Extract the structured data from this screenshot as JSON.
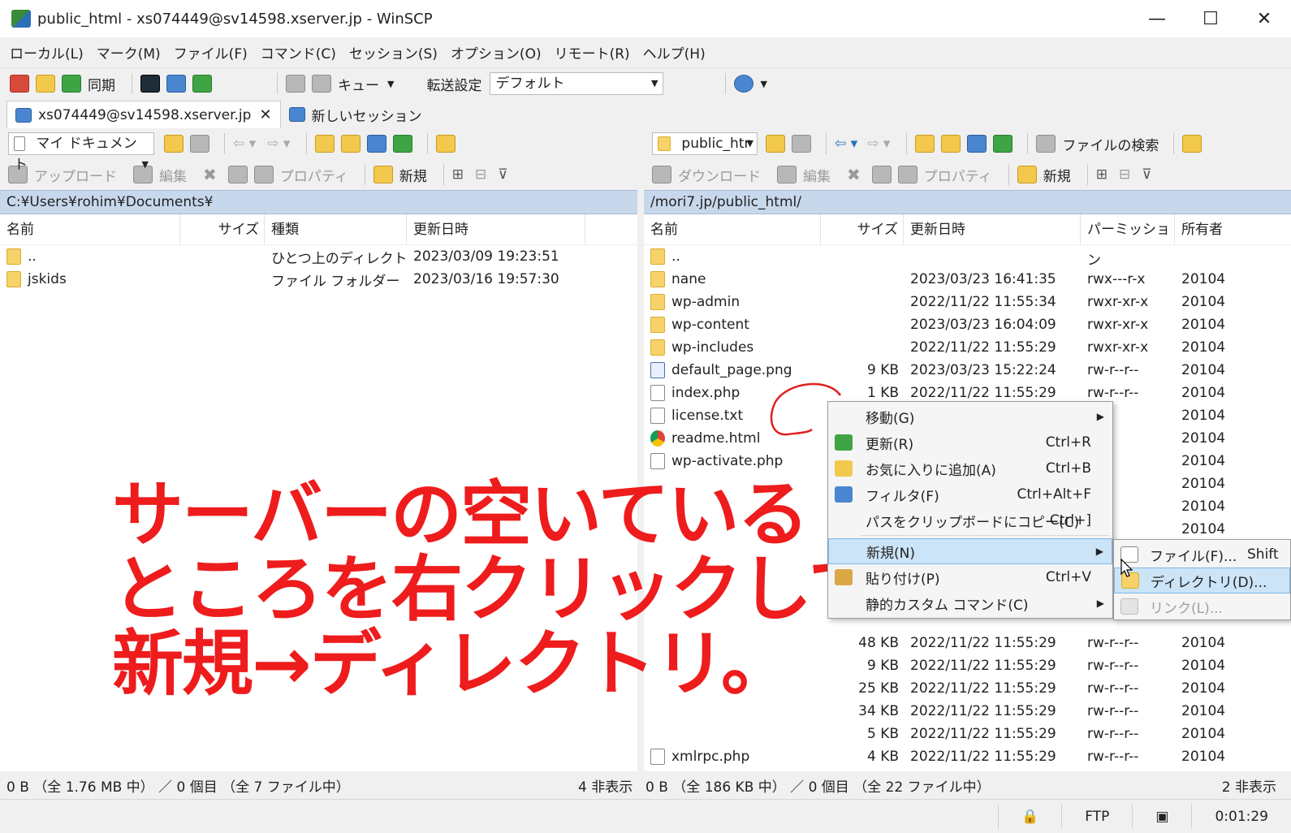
{
  "window": {
    "title": "public_html - xs074449@sv14598.xserver.jp - WinSCP"
  },
  "menu": [
    "ローカル(L)",
    "マーク(M)",
    "ファイル(F)",
    "コマンド(C)",
    "セッション(S)",
    "オプション(O)",
    "リモート(R)",
    "ヘルプ(H)"
  ],
  "toolbar": {
    "sync_label": "同期",
    "queue_label": "キュー",
    "transfer_label": "転送設定",
    "transfer_value": "デフォルト"
  },
  "tabs": {
    "session": "xs074449@sv14598.xserver.jp",
    "new_session": "新しいセッション"
  },
  "left": {
    "location": "マイ ドキュメント",
    "upload": "アップロード",
    "edit": "編集",
    "properties": "プロパティ",
    "new": "新規",
    "path": "C:¥Users¥rohim¥Documents¥",
    "columns": [
      "名前",
      "サイズ",
      "種類",
      "更新日時"
    ],
    "rows": [
      {
        "name": "..",
        "size": "",
        "type": "ひとつ上のディレクトリ",
        "date": "2023/03/09  19:23:51"
      },
      {
        "name": "jskids",
        "size": "",
        "type": "ファイル フォルダー",
        "date": "2023/03/16  19:57:30"
      }
    ],
    "status": "0 B （全 1.76 MB 中） ／ 0 個目 （全 7 ファイル中）",
    "hidden": "4 非表示"
  },
  "right": {
    "location": "public_htr",
    "download": "ダウンロード",
    "edit": "編集",
    "properties": "プロパティ",
    "new": "新規",
    "find": "ファイルの検索",
    "path": "/mori7.jp/public_html/",
    "columns": [
      "名前",
      "サイズ",
      "更新日時",
      "パーミッション",
      "所有者"
    ],
    "rows": [
      {
        "name": "..",
        "size": "",
        "date": "",
        "perm": "",
        "owner": "",
        "icon": "up"
      },
      {
        "name": "nane",
        "size": "",
        "date": "2023/03/23 16:41:35",
        "perm": "rwx---r-x",
        "owner": "20104",
        "icon": "folder"
      },
      {
        "name": "wp-admin",
        "size": "",
        "date": "2022/11/22 11:55:34",
        "perm": "rwxr-xr-x",
        "owner": "20104",
        "icon": "folder"
      },
      {
        "name": "wp-content",
        "size": "",
        "date": "2023/03/23 16:04:09",
        "perm": "rwxr-xr-x",
        "owner": "20104",
        "icon": "folder"
      },
      {
        "name": "wp-includes",
        "size": "",
        "date": "2022/11/22 11:55:29",
        "perm": "rwxr-xr-x",
        "owner": "20104",
        "icon": "folder"
      },
      {
        "name": "default_page.png",
        "size": "9 KB",
        "date": "2023/03/23 15:22:24",
        "perm": "rw-r--r--",
        "owner": "20104",
        "icon": "img"
      },
      {
        "name": "index.php",
        "size": "1 KB",
        "date": "2022/11/22 11:55:29",
        "perm": "rw-r--r--",
        "owner": "20104",
        "icon": "file"
      },
      {
        "name": "license.txt",
        "size": "",
        "date": "",
        "perm": "--r--",
        "owner": "20104",
        "icon": "file"
      },
      {
        "name": "readme.html",
        "size": "",
        "date": "",
        "perm": "--r--",
        "owner": "20104",
        "icon": "chrome"
      },
      {
        "name": "wp-activate.php",
        "size": "",
        "date": "",
        "perm": "--r--",
        "owner": "20104",
        "icon": "file"
      },
      {
        "name": "",
        "size": "",
        "date": "",
        "perm": "--r--",
        "owner": "20104",
        "icon": ""
      },
      {
        "name": "",
        "size": "",
        "date": "",
        "perm": "--r--",
        "owner": "20104",
        "icon": ""
      },
      {
        "name": "",
        "size": "",
        "date": "",
        "perm": "-----",
        "owner": "20104",
        "icon": ""
      }
    ],
    "rows_bottom": [
      {
        "name": "",
        "size": "48 KB",
        "date": "2022/11/22 11:55:29",
        "perm": "rw-r--r--",
        "owner": "20104",
        "icon": ""
      },
      {
        "name": "",
        "size": "9 KB",
        "date": "2022/11/22 11:55:29",
        "perm": "rw-r--r--",
        "owner": "20104",
        "icon": ""
      },
      {
        "name": "",
        "size": "25 KB",
        "date": "2022/11/22 11:55:29",
        "perm": "rw-r--r--",
        "owner": "20104",
        "icon": ""
      },
      {
        "name": "",
        "size": "34 KB",
        "date": "2022/11/22 11:55:29",
        "perm": "rw-r--r--",
        "owner": "20104",
        "icon": ""
      },
      {
        "name": "",
        "size": "5 KB",
        "date": "2022/11/22 11:55:29",
        "perm": "rw-r--r--",
        "owner": "20104",
        "icon": ""
      },
      {
        "name": "xmlrpc.php",
        "size": "4 KB",
        "date": "2022/11/22 11:55:29",
        "perm": "rw-r--r--",
        "owner": "20104",
        "icon": "file"
      }
    ],
    "status": "0 B （全 186 KB 中） ／ 0 個目 （全 22 ファイル中）",
    "hidden": "2 非表示"
  },
  "context_menu": [
    {
      "label": "移動(G)",
      "shortcut": "",
      "sub": true
    },
    {
      "label": "更新(R)",
      "shortcut": "Ctrl+R",
      "sub": false
    },
    {
      "label": "お気に入りに追加(A)",
      "shortcut": "Ctrl+B",
      "sub": false
    },
    {
      "label": "フィルタ(F)",
      "shortcut": "Ctrl+Alt+F",
      "sub": false
    },
    {
      "label": "パスをクリップボードにコピー(C)",
      "shortcut": "Ctrl+]",
      "sub": false
    },
    {
      "label": "新規(N)",
      "shortcut": "",
      "sub": true
    },
    {
      "label": "貼り付け(P)",
      "shortcut": "Ctrl+V",
      "sub": false
    },
    {
      "label": "静的カスタム コマンド(C)",
      "shortcut": "",
      "sub": true
    }
  ],
  "submenu": [
    {
      "label": "ファイル(F)...",
      "shortcut": "Shift"
    },
    {
      "label": "ディレクトリ(D)...",
      "shortcut": ""
    },
    {
      "label": "リンク(L)...",
      "shortcut": ""
    }
  ],
  "statusbar": {
    "protocol": "FTP",
    "time": "0:01:29"
  },
  "annotation": [
    "サーバーの空いている",
    "ところを右クリックして",
    "新規→ディレクトリ。"
  ],
  "colors": {
    "annotation": "#ee1c1c",
    "path_bar": "#c8d8ec",
    "highlight": "#cce4f7"
  }
}
